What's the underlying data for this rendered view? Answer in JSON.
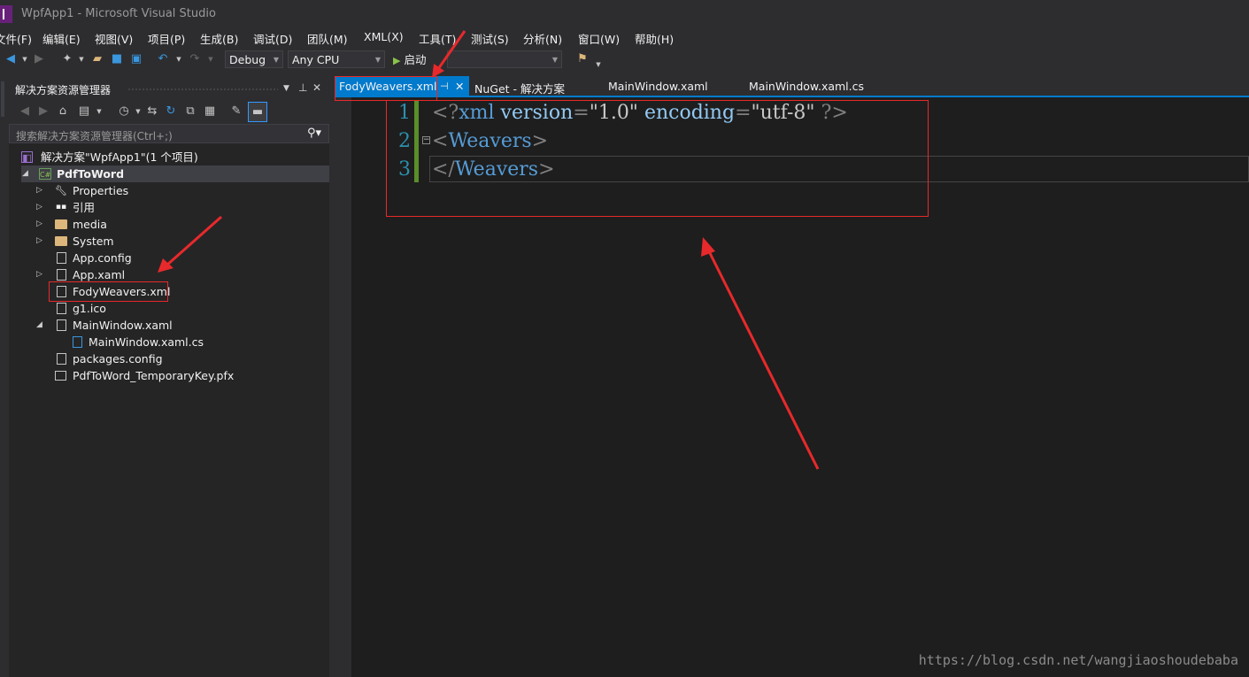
{
  "window": {
    "title": "WpfApp1 - Microsoft Visual Studio"
  },
  "menu": [
    "文件(F)",
    "编辑(E)",
    "视图(V)",
    "项目(P)",
    "生成(B)",
    "调试(D)",
    "团队(M)",
    "XML(X)",
    "工具(T)",
    "测试(S)",
    "分析(N)",
    "窗口(W)",
    "帮助(H)"
  ],
  "toolbar": {
    "configuration": "Debug",
    "platform": "Any CPU",
    "start_label": "启动"
  },
  "solution_explorer": {
    "title": "解决方案资源管理器",
    "search_placeholder": "搜索解决方案资源管理器(Ctrl+;)",
    "solution_label": "解决方案\"WpfApp1\"(1 个项目)",
    "project_label": "PdfToWord",
    "items": [
      "Properties",
      "引用",
      "media",
      "System",
      "App.config",
      "App.xaml",
      "FodyWeavers.xml",
      "g1.ico",
      "MainWindow.xaml",
      "MainWindow.xaml.cs",
      "packages.config",
      "PdfToWord_TemporaryKey.pfx"
    ]
  },
  "tabs": [
    "FodyWeavers.xml",
    "NuGet - 解决方案",
    "MainWindow.xaml",
    "MainWindow.xaml.cs"
  ],
  "editor": {
    "line_numbers": [
      "1",
      "2",
      "3"
    ],
    "line1": {
      "open": "<?",
      "xml": "xml",
      "attr1": "version",
      "eq1": "=",
      "val1": "\"1.0\"",
      "attr2": "encoding",
      "eq2": "=",
      "val2": "\"utf-8\"",
      "close": "?>"
    },
    "line2": {
      "lt": "<",
      "tag": "Weavers",
      "gt": ">"
    },
    "line3": {
      "lt": "</",
      "tag": "Weavers",
      "gt": ">"
    }
  },
  "watermark": "https://blog.csdn.net/wangjiaoshoudebaba",
  "colors": {
    "accent": "#007acc",
    "annotation": "#e8292b",
    "xml_delimiter": "#808080",
    "xml_name": "#569cd6",
    "xml_attr": "#92caf4",
    "xml_value": "#c8c8c8"
  }
}
